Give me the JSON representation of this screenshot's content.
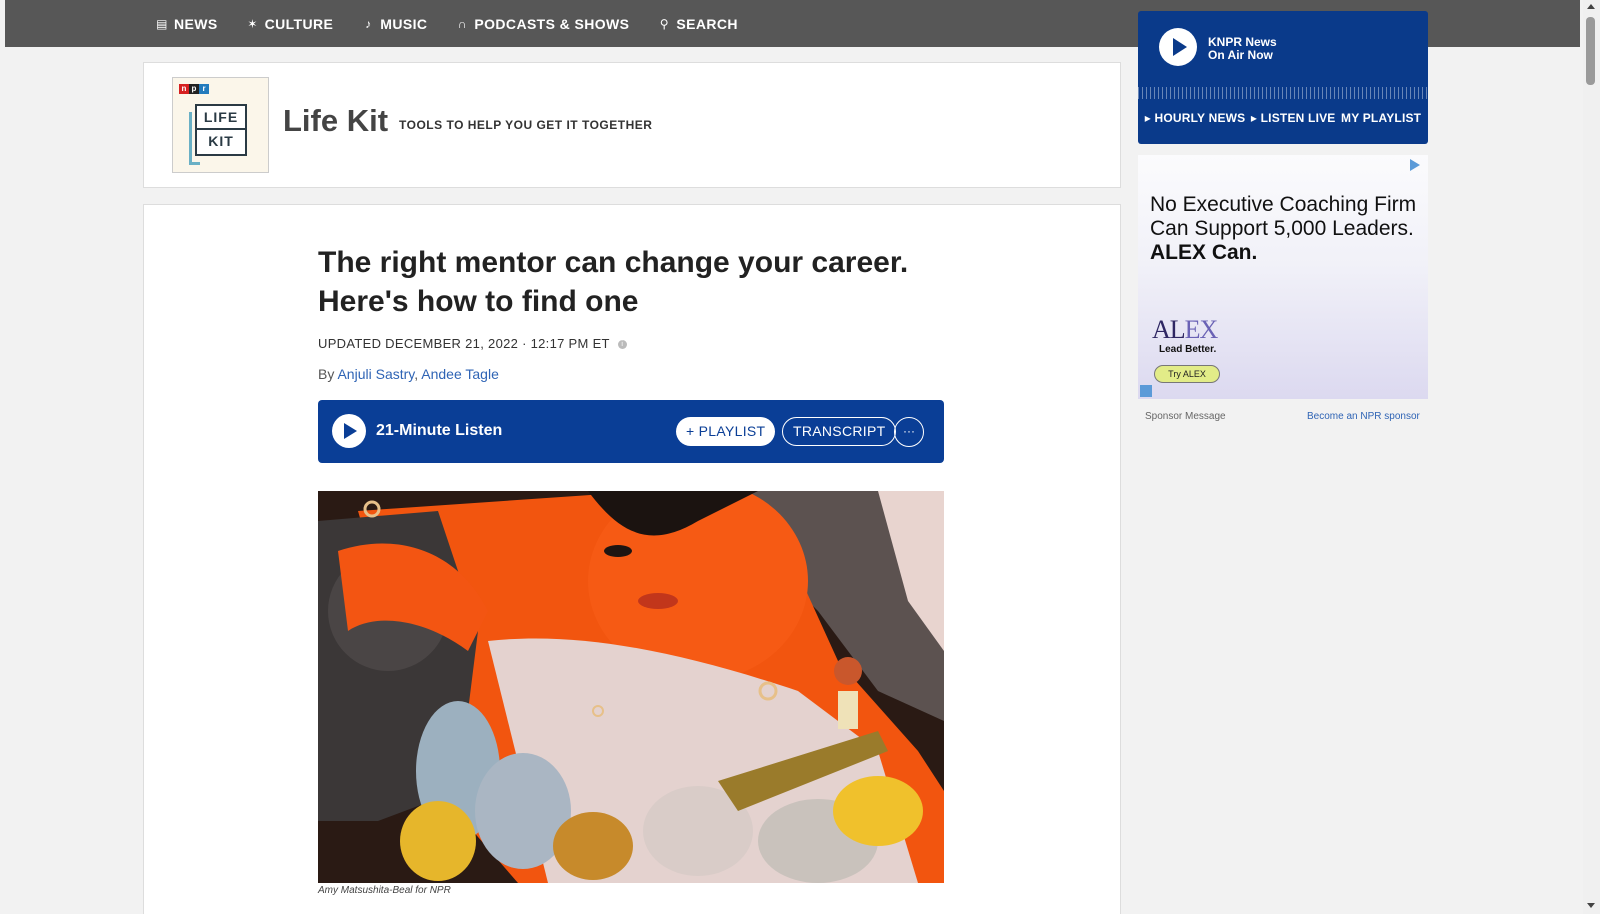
{
  "nav": {
    "items": [
      {
        "label": "NEWS",
        "icon": "news-icon"
      },
      {
        "label": "CULTURE",
        "icon": "culture-icon"
      },
      {
        "label": "MUSIC",
        "icon": "music-icon"
      },
      {
        "label": "PODCASTS & SHOWS",
        "icon": "headphones-icon"
      },
      {
        "label": "SEARCH",
        "icon": "search-icon"
      }
    ]
  },
  "player": {
    "station": "KNPR News",
    "status": "On Air Now",
    "links": [
      "HOURLY NEWS",
      "LISTEN LIVE",
      "MY PLAYLIST"
    ]
  },
  "show": {
    "logo_top": "LIFE",
    "logo_bottom": "KIT",
    "npr_letters": [
      "n",
      "p",
      "r"
    ],
    "title": "Life Kit",
    "tagline": "TOOLS TO HELP YOU GET IT TOGETHER"
  },
  "article": {
    "headline": "The right mentor can change your career. Here's how to find one",
    "updated": "UPDATED DECEMBER 21, 2022 · 12:17 PM ET",
    "by_prefix": "By",
    "authors": [
      "Anjuli Sastry",
      "Andee Tagle"
    ],
    "author_separator": ", ",
    "audio": {
      "duration": "21-Minute Listen",
      "playlist": "+ PLAYLIST",
      "transcript": "TRANSCRIPT",
      "more": "···"
    },
    "image_credit": "Amy Matsushita-Beal for NPR"
  },
  "ad": {
    "headline_start": "No Executive Coaching Firm Can Support 5,000 Leaders.",
    "headline_bold": "ALEX Can.",
    "brand_a": "AL",
    "brand_b": "EX",
    "brand_tag": "Lead Better.",
    "cta": "Try ALEX",
    "sponsor_label": "Sponsor Message",
    "become_sponsor": "Become an NPR sponsor"
  },
  "colors": {
    "nav_bg": "#575757",
    "player_blue": "#0a3a8a",
    "link_blue": "#2f64b5"
  }
}
